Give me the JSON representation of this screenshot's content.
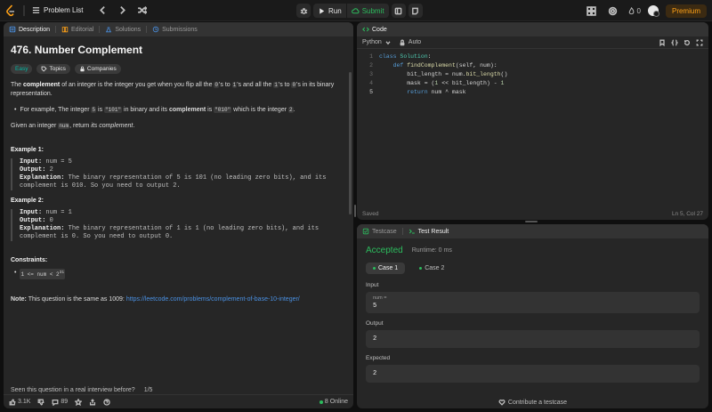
{
  "topbar": {
    "problem_list": "Problem List",
    "run_label": "Run",
    "submit_label": "Submit",
    "streak_count": "0",
    "premium_label": "Premium"
  },
  "description": {
    "tabs": [
      "Description",
      "Editorial",
      "Solutions",
      "Submissions"
    ],
    "title": "476. Number Complement",
    "badges": [
      "Easy",
      "Topics",
      "Companies"
    ],
    "intro": {
      "p1_a": "The ",
      "p1_b": "complement",
      "p1_c": " of an integer is the integer you get when you flip all the ",
      "p1_d": "0",
      "p1_e": "'s to ",
      "p1_f": "1",
      "p1_g": "'s and all the ",
      "p1_h": "1",
      "p1_i": "'s to ",
      "p1_j": "0",
      "p1_k": "'s in its binary representation."
    },
    "bullet": {
      "a": "For example, The integer ",
      "b": "5",
      "c": " is ",
      "d": "\"101\"",
      "e": " in binary and its ",
      "f": "complement",
      "g": " is ",
      "h": "\"010\"",
      "i": " which is the integer ",
      "j": "2",
      "k": "."
    },
    "given": {
      "a": "Given an integer ",
      "b": "num",
      "c": ", return ",
      "d": "its complement",
      "e": "."
    },
    "examples": [
      {
        "title": "Example 1:",
        "input_label": "Input:",
        "input": " num = 5",
        "output_label": "Output:",
        "output": " 2",
        "explanation_label": "Explanation:",
        "explanation": " The binary representation of 5 is 101 (no leading zero bits), and its complement is 010. So you need to output 2."
      },
      {
        "title": "Example 2:",
        "input_label": "Input:",
        "input": " num = 1",
        "output_label": "Output:",
        "output": " 0",
        "explanation_label": "Explanation:",
        "explanation": " The binary representation of 1 is 1 (no leading zero bits), and its complement is 0. So you need to output 0."
      }
    ],
    "constraints_title": "Constraints:",
    "constraint": "1 <= num < 2",
    "constraint_sup": "31",
    "note_label": "Note:",
    "note_text": " This question is the same as 1009: ",
    "note_link": "https://leetcode.com/problems/complement-of-base-10-integer/",
    "seen_text": "Seen this question in a real interview before?",
    "seen_page": "1/5",
    "footer": {
      "likes": "3.1K",
      "comments": "89",
      "online": "8 Online"
    }
  },
  "code": {
    "tab_label": "Code",
    "language": "Python",
    "auto_label": "Auto",
    "lines": [
      {
        "n": "1",
        "text": "class Solution:"
      },
      {
        "n": "2",
        "text": "    def findComplement(self, num):"
      },
      {
        "n": "3",
        "text": "        bit_length = num.bit_length()"
      },
      {
        "n": "4",
        "text": "        mask = (1 << bit_length) - 1"
      },
      {
        "n": "5",
        "text": "        return num ^ mask"
      }
    ],
    "status_left": "Saved",
    "status_right": "Ln 5, Col 27"
  },
  "result": {
    "tabs": [
      "Testcase",
      "Test Result"
    ],
    "status": "Accepted",
    "runtime": "Runtime: 0 ms",
    "cases": [
      "Case 1",
      "Case 2"
    ],
    "input_label": "Input",
    "input_var": "num =",
    "input_val": "5",
    "output_label": "Output",
    "output_val": "2",
    "expected_label": "Expected",
    "expected_val": "2",
    "contribute": "Contribute a testcase"
  }
}
